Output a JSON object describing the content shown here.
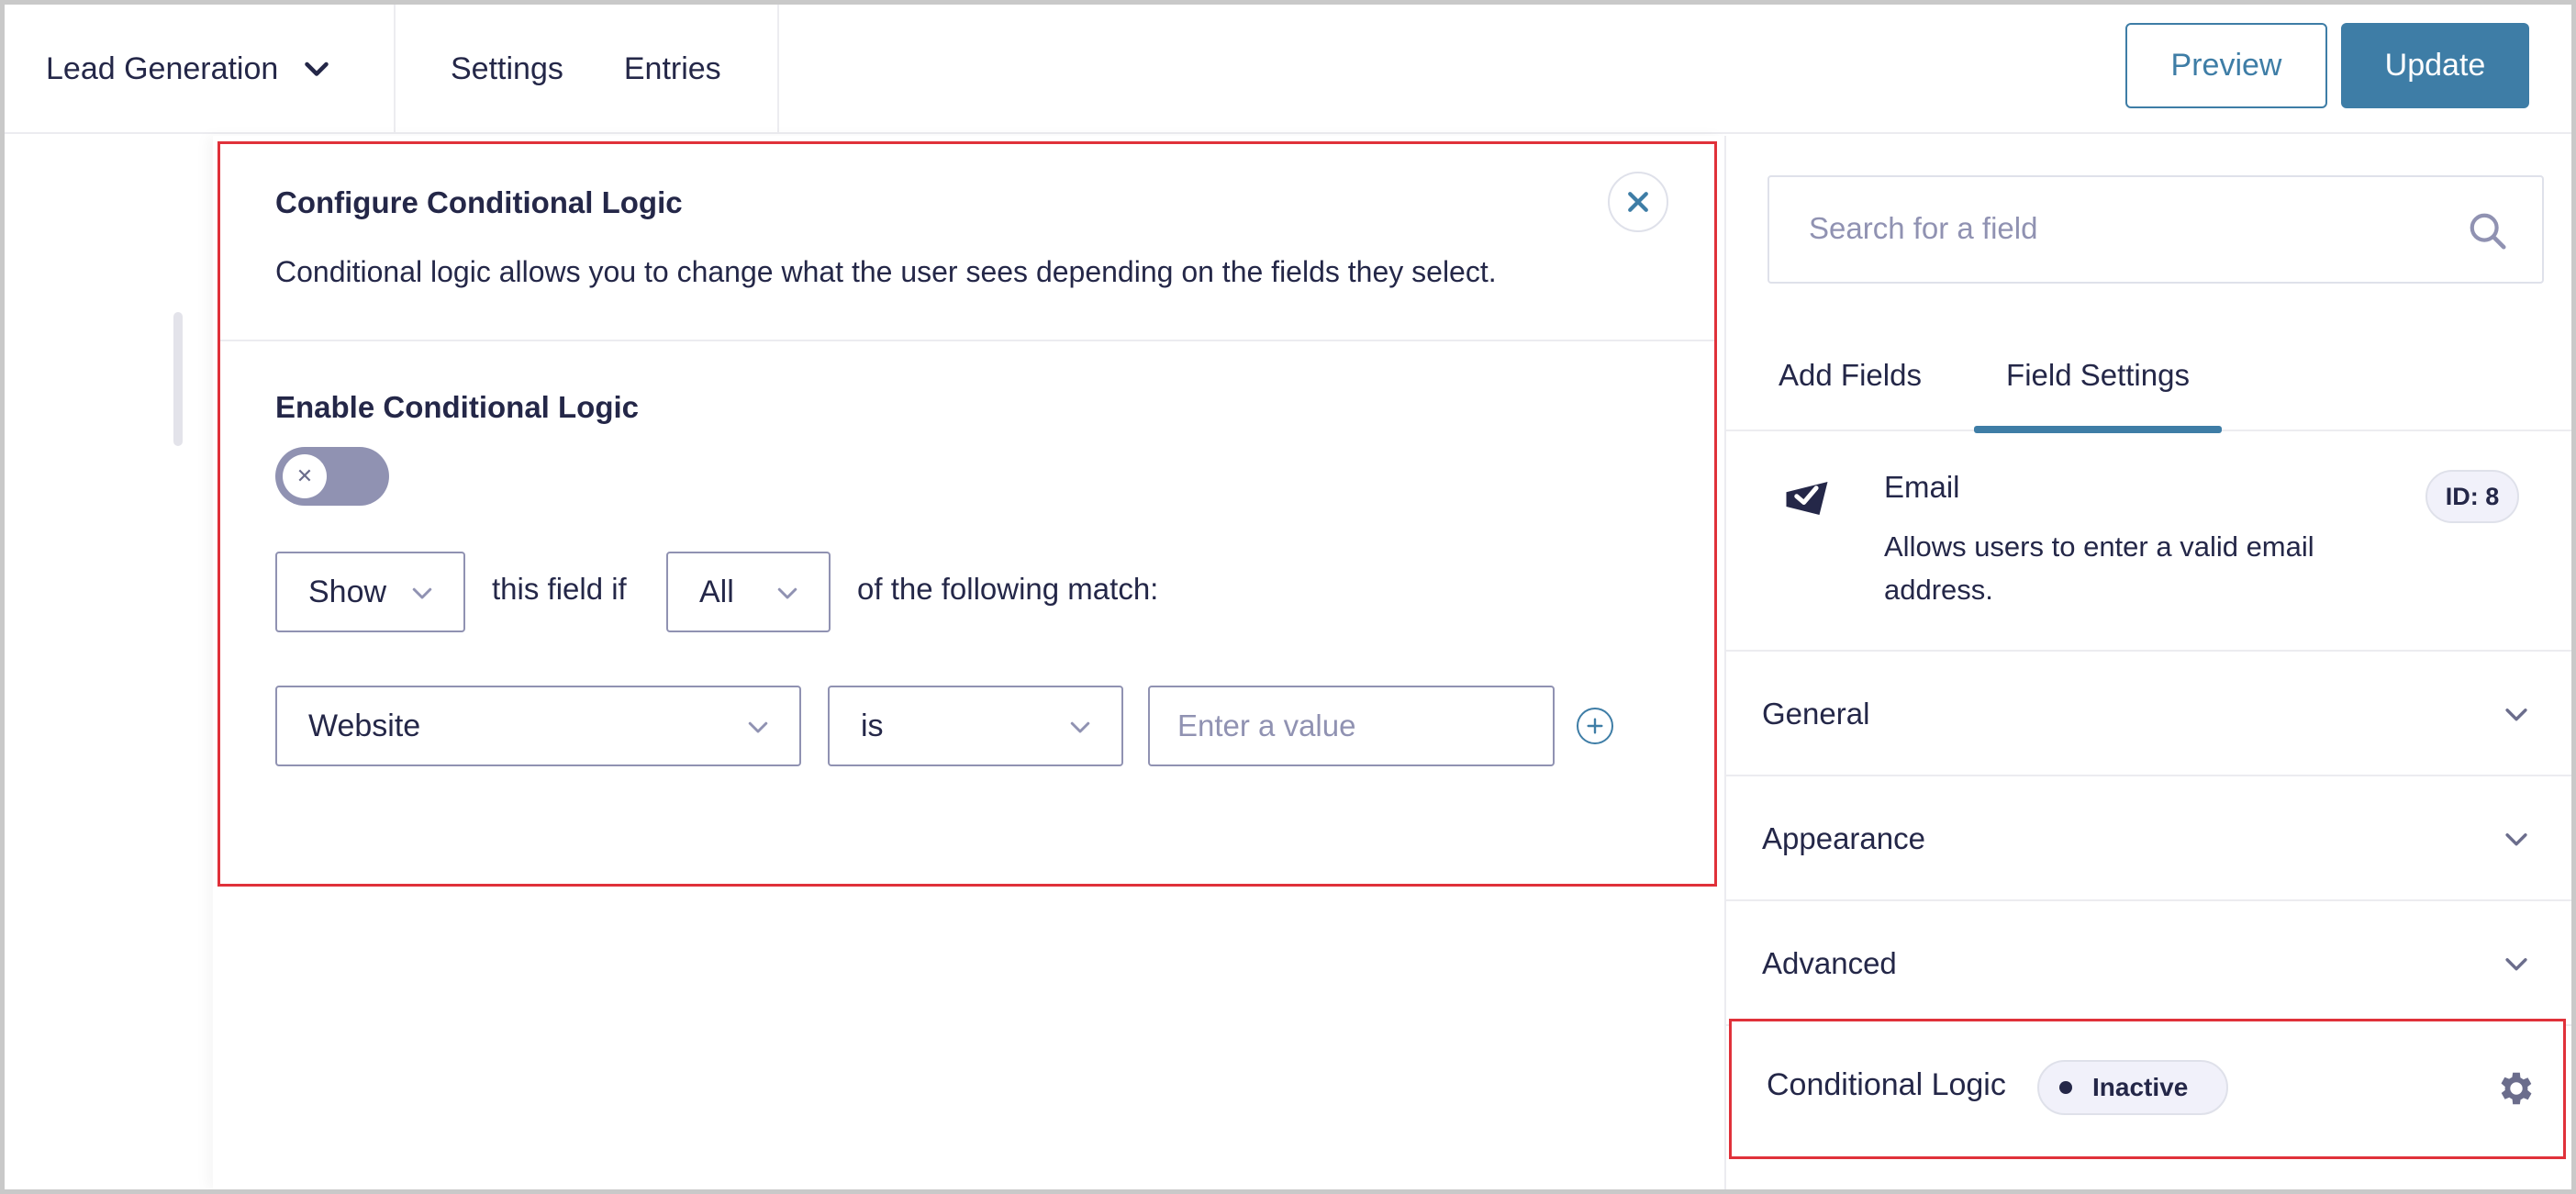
{
  "topbar": {
    "form_name": "Lead Generation",
    "nav": {
      "settings": "Settings",
      "entries": "Entries"
    },
    "preview_label": "Preview",
    "update_label": "Update"
  },
  "flyout": {
    "title": "Configure Conditional Logic",
    "description": "Conditional logic allows you to change what the user sees depending on the fields they select.",
    "enable_label": "Enable Conditional Logic",
    "enabled": false,
    "action_select": "Show",
    "text_this_field_if": "this field if",
    "logic_type_select": "All",
    "text_following_match": "of the following match:",
    "rule": {
      "field_select": "Website",
      "operator_select": "is",
      "value_placeholder": "Enter a value",
      "value": ""
    }
  },
  "sidebar": {
    "search_placeholder": "Search for a field",
    "tabs": [
      {
        "label": "Add Fields",
        "active": false
      },
      {
        "label": "Field Settings",
        "active": true
      }
    ],
    "field": {
      "icon": "envelope-check-icon",
      "name": "Email",
      "description": "Allows users to enter a valid email address.",
      "id_badge": "ID: 8"
    },
    "sections": {
      "general": "General",
      "appearance": "Appearance",
      "advanced": "Advanced"
    },
    "conditional_logic": {
      "label": "Conditional Logic",
      "status": "Inactive"
    }
  },
  "colors": {
    "primary": "#3e7da6",
    "text": "#242748",
    "muted": "#9092b2",
    "highlight": "#e0313a"
  }
}
